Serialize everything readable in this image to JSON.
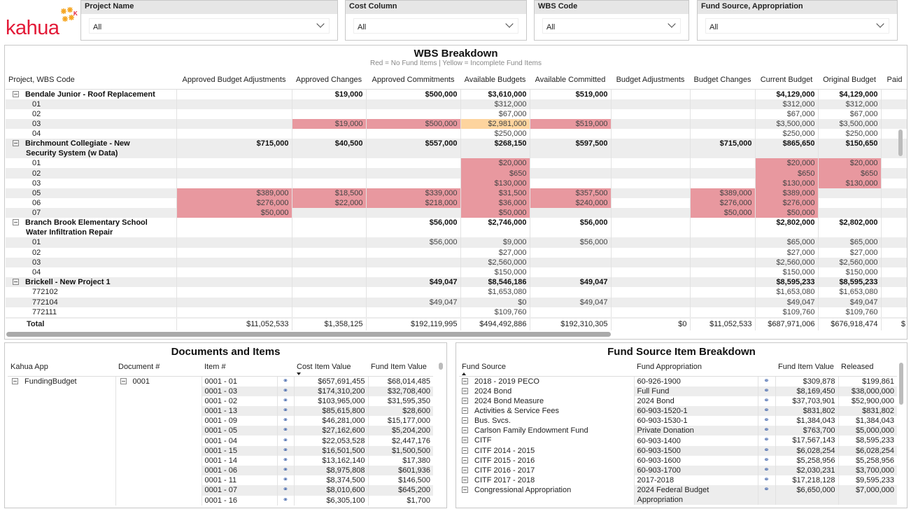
{
  "logo": {
    "text": "kahua",
    "brand_color": "#e31937",
    "accent_color": "#f5a623"
  },
  "slicers": [
    {
      "label": "Project Name",
      "value": "All"
    },
    {
      "label": "Cost Column",
      "value": "All"
    },
    {
      "label": "WBS Code",
      "value": "All"
    },
    {
      "label": "Fund Source, Appropriation",
      "value": "All"
    }
  ],
  "wbs": {
    "title": "WBS Breakdown",
    "subtitle": "Red = No Fund Items | Yellow = Incomplete Fund Items",
    "colors": {
      "red": "#e8989f",
      "yellow": "#fdd49e"
    },
    "columns": [
      "Project, WBS Code",
      "Approved Budget Adjustments",
      "Approved Changes",
      "Approved Commitments",
      "Available Budgets",
      "Available Committed",
      "Budget Adjustments",
      "Budget Changes",
      "Current Budget",
      "Original Budget",
      "Paid"
    ],
    "rows": [
      {
        "label": "Bendale Junior - Roof Replacement",
        "project": true,
        "values": [
          "",
          "$19,000",
          "$500,000",
          "$3,610,000",
          "$519,000",
          "",
          "",
          "$4,129,000",
          "$4,129,000",
          ""
        ],
        "flags": [
          "",
          "",
          "",
          "",
          "",
          "",
          "",
          "",
          "",
          ""
        ]
      },
      {
        "label": "01",
        "values": [
          "",
          "",
          "",
          "$312,000",
          "",
          "",
          "",
          "$312,000",
          "$312,000",
          ""
        ],
        "flags": [
          "",
          "",
          "",
          "",
          "",
          "",
          "",
          "",
          "",
          ""
        ]
      },
      {
        "label": "02",
        "values": [
          "",
          "",
          "",
          "$67,000",
          "",
          "",
          "",
          "$67,000",
          "$67,000",
          ""
        ],
        "flags": [
          "",
          "",
          "",
          "",
          "",
          "",
          "",
          "",
          "",
          ""
        ]
      },
      {
        "label": "03",
        "values": [
          "",
          "$19,000",
          "$500,000",
          "$2,981,000",
          "$519,000",
          "",
          "",
          "$3,500,000",
          "$3,500,000",
          ""
        ],
        "flags": [
          "",
          "r",
          "r",
          "y",
          "r",
          "",
          "",
          "",
          "",
          ""
        ]
      },
      {
        "label": "04",
        "values": [
          "",
          "",
          "",
          "$250,000",
          "",
          "",
          "",
          "$250,000",
          "$250,000",
          ""
        ],
        "flags": [
          "",
          "",
          "",
          "",
          "",
          "",
          "",
          "",
          "",
          ""
        ]
      },
      {
        "label": "Birchmount Collegiate - New Security System (w Data)",
        "project": true,
        "values": [
          "$715,000",
          "$40,500",
          "$557,000",
          "$268,150",
          "$597,500",
          "",
          "$715,000",
          "$865,650",
          "$150,650",
          ""
        ],
        "flags": [
          "",
          "",
          "",
          "",
          "",
          "",
          "",
          "",
          "",
          ""
        ]
      },
      {
        "label": "01",
        "values": [
          "",
          "",
          "",
          "$20,000",
          "",
          "",
          "",
          "$20,000",
          "$20,000",
          ""
        ],
        "flags": [
          "",
          "",
          "",
          "r",
          "",
          "",
          "",
          "r",
          "r",
          ""
        ]
      },
      {
        "label": "02",
        "values": [
          "",
          "",
          "",
          "$650",
          "",
          "",
          "",
          "$650",
          "$650",
          ""
        ],
        "flags": [
          "",
          "",
          "",
          "r",
          "",
          "",
          "",
          "r",
          "r",
          ""
        ]
      },
      {
        "label": "03",
        "values": [
          "",
          "",
          "",
          "$130,000",
          "",
          "",
          "",
          "$130,000",
          "$130,000",
          ""
        ],
        "flags": [
          "",
          "",
          "",
          "r",
          "",
          "",
          "",
          "r",
          "r",
          ""
        ]
      },
      {
        "label": "05",
        "values": [
          "$389,000",
          "$18,500",
          "$339,000",
          "$31,500",
          "$357,500",
          "",
          "$389,000",
          "$389,000",
          "",
          ""
        ],
        "flags": [
          "r",
          "r",
          "r",
          "r",
          "r",
          "",
          "r",
          "r",
          "",
          ""
        ]
      },
      {
        "label": "06",
        "values": [
          "$276,000",
          "$22,000",
          "$218,000",
          "$36,000",
          "$240,000",
          "",
          "$276,000",
          "$276,000",
          "",
          ""
        ],
        "flags": [
          "r",
          "r",
          "r",
          "r",
          "r",
          "",
          "r",
          "r",
          "",
          ""
        ]
      },
      {
        "label": "07",
        "values": [
          "$50,000",
          "",
          "",
          "$50,000",
          "",
          "",
          "$50,000",
          "$50,000",
          "",
          ""
        ],
        "flags": [
          "r",
          "",
          "",
          "r",
          "",
          "",
          "r",
          "r",
          "",
          ""
        ]
      },
      {
        "label": "Branch Brook Elementary School Water Infiltration Repair",
        "project": true,
        "values": [
          "",
          "",
          "$56,000",
          "$2,746,000",
          "$56,000",
          "",
          "",
          "$2,802,000",
          "$2,802,000",
          ""
        ],
        "flags": [
          "",
          "",
          "",
          "",
          "",
          "",
          "",
          "",
          "",
          ""
        ]
      },
      {
        "label": "01",
        "values": [
          "",
          "",
          "$56,000",
          "$9,000",
          "$56,000",
          "",
          "",
          "$65,000",
          "$65,000",
          ""
        ],
        "flags": [
          "",
          "",
          "",
          "",
          "",
          "",
          "",
          "",
          "",
          ""
        ]
      },
      {
        "label": "02",
        "values": [
          "",
          "",
          "",
          "$27,000",
          "",
          "",
          "",
          "$27,000",
          "$27,000",
          ""
        ],
        "flags": [
          "",
          "",
          "",
          "",
          "",
          "",
          "",
          "",
          "",
          ""
        ]
      },
      {
        "label": "03",
        "values": [
          "",
          "",
          "",
          "$2,560,000",
          "",
          "",
          "",
          "$2,560,000",
          "$2,560,000",
          ""
        ],
        "flags": [
          "",
          "",
          "",
          "",
          "",
          "",
          "",
          "",
          "",
          ""
        ]
      },
      {
        "label": "04",
        "values": [
          "",
          "",
          "",
          "$150,000",
          "",
          "",
          "",
          "$150,000",
          "$150,000",
          ""
        ],
        "flags": [
          "",
          "",
          "",
          "",
          "",
          "",
          "",
          "",
          "",
          ""
        ]
      },
      {
        "label": "Brickell - New Project 1",
        "project": true,
        "values": [
          "",
          "",
          "$49,047",
          "$8,546,186",
          "$49,047",
          "",
          "",
          "$8,595,233",
          "$8,595,233",
          ""
        ],
        "flags": [
          "",
          "",
          "",
          "",
          "",
          "",
          "",
          "",
          "",
          ""
        ]
      },
      {
        "label": "772102",
        "values": [
          "",
          "",
          "",
          "$1,653,080",
          "",
          "",
          "",
          "$1,653,080",
          "$1,653,080",
          ""
        ],
        "flags": [
          "",
          "",
          "",
          "",
          "",
          "",
          "",
          "",
          "",
          ""
        ]
      },
      {
        "label": "772104",
        "values": [
          "",
          "",
          "$49,047",
          "$0",
          "$49,047",
          "",
          "",
          "$49,047",
          "$49,047",
          ""
        ],
        "flags": [
          "",
          "",
          "",
          "",
          "",
          "",
          "",
          "",
          "",
          ""
        ]
      },
      {
        "label": "772111",
        "values": [
          "",
          "",
          "",
          "$109,760",
          "",
          "",
          "",
          "$109,760",
          "$109,760",
          ""
        ],
        "flags": [
          "",
          "",
          "",
          "",
          "",
          "",
          "",
          "",
          "",
          ""
        ]
      }
    ],
    "total": {
      "label": "Total",
      "values": [
        "$11,052,533",
        "$1,358,125",
        "$192,119,995",
        "$494,492,886",
        "$192,310,305",
        "$0",
        "$11,052,533",
        "$687,971,006",
        "$676,918,474",
        "$"
      ]
    }
  },
  "documents": {
    "title": "Documents and Items",
    "columns": [
      "Kahua App",
      "Document #",
      "Item #",
      "",
      "Cost Item Value",
      "Fund Item Value"
    ],
    "app": "FundingBudget",
    "document": "0001",
    "link_icon": "link-icon",
    "rows": [
      [
        "0001 - 01",
        "$657,691,455",
        "$68,014,485"
      ],
      [
        "0001 - 03",
        "$174,310,200",
        "$32,708,400"
      ],
      [
        "0001 - 02",
        "$103,965,000",
        "$31,595,350"
      ],
      [
        "0001 - 13",
        "$85,615,800",
        "$28,600"
      ],
      [
        "0001 - 09",
        "$46,281,000",
        "$15,177,000"
      ],
      [
        "0001 - 05",
        "$27,162,600",
        "$5,204,200"
      ],
      [
        "0001 - 04",
        "$22,053,528",
        "$2,447,176"
      ],
      [
        "0001 - 15",
        "$16,501,500",
        "$1,500,500"
      ],
      [
        "0001 - 14",
        "$13,162,140",
        "$17,380"
      ],
      [
        "0001 - 06",
        "$8,975,808",
        "$601,936"
      ],
      [
        "0001 - 11",
        "$8,374,500",
        "$146,500"
      ],
      [
        "0001 - 07",
        "$8,010,600",
        "$645,200"
      ],
      [
        "0001 - 16",
        "$6,305,100",
        "$1,700"
      ]
    ]
  },
  "fund_source": {
    "title": "Fund Source Item Breakdown",
    "columns": [
      "Fund Source",
      "Fund Appropriation",
      "",
      "Fund Item Value",
      "Released"
    ],
    "rows": [
      [
        "2018 - 2019 PECO",
        "60-926-1900",
        "$309,878",
        "$199,861"
      ],
      [
        "2024 Bond",
        "Full Fund",
        "$8,169,450",
        "$38,000,000"
      ],
      [
        "2024 Bond Measure",
        "2024 Bond",
        "$37,703,901",
        "$52,900,000"
      ],
      [
        "Activities & Service Fees",
        "60-903-1520-1",
        "$831,802",
        "$831,802"
      ],
      [
        "Bus. Svcs.",
        "60-903-1530-1",
        "$1,384,043",
        "$1,384,043"
      ],
      [
        "Carlson Family Endowment Fund",
        "Private Donation",
        "$763,700",
        "$5,000,000"
      ],
      [
        "CITF",
        "60-903-1400",
        "$17,567,143",
        "$8,595,233"
      ],
      [
        "CITF 2014 - 2015",
        "60-903-1500",
        "$6,028,254",
        "$6,028,254"
      ],
      [
        "CITF 2015 - 2016",
        "60-903-1600",
        "$5,258,956",
        "$5,258,956"
      ],
      [
        "CITF 2016 - 2017",
        "60-903-1700",
        "$2,030,231",
        "$3,700,000"
      ],
      [
        "CITF 2017 - 2018",
        "2017-2018",
        "$17,218,128",
        "$9,595,233"
      ],
      [
        "Congressional Appropriation",
        "2024 Federal Budget Appropriation",
        "$6,650,000",
        "$7,000,000"
      ]
    ]
  }
}
